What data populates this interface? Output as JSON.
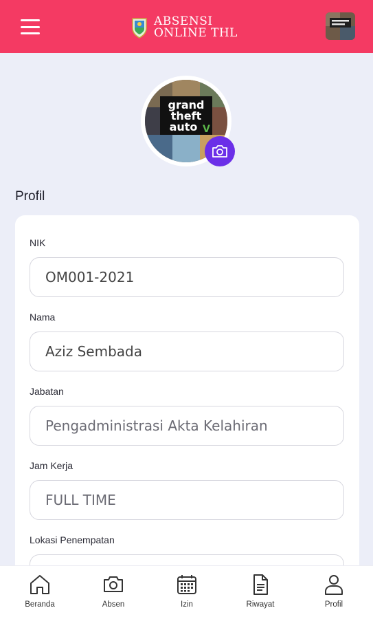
{
  "header": {
    "title_line1": "ABSENSI",
    "title_line2": "ONLINE THL",
    "menu_icon": "hamburger-menu-icon",
    "avatar_icon": "user-avatar-thumbnail"
  },
  "profile_photo": {
    "image_text_1": "grand",
    "image_text_2": "theft",
    "image_text_3": "auto",
    "badge_icon": "camera-icon"
  },
  "section": {
    "title": "Profil"
  },
  "form": {
    "fields": [
      {
        "label": "NIK",
        "value": "OM001-2021"
      },
      {
        "label": "Nama",
        "value": "Aziz Sembada"
      },
      {
        "label": "Jabatan",
        "value": "Pengadministrasi Akta Kelahiran"
      },
      {
        "label": "Jam Kerja",
        "value": "FULL TIME"
      },
      {
        "label": "Lokasi Penempatan",
        "value": ""
      }
    ]
  },
  "nav": {
    "items": [
      {
        "label": "Beranda",
        "icon": "home-icon"
      },
      {
        "label": "Absen",
        "icon": "camera-icon"
      },
      {
        "label": "Izin",
        "icon": "calendar-icon"
      },
      {
        "label": "Riwayat",
        "icon": "document-icon"
      },
      {
        "label": "Profil",
        "icon": "user-icon"
      }
    ]
  },
  "colors": {
    "header_bg": "#f43a63",
    "accent": "#6b2fe8",
    "page_bg": "#eceef8"
  }
}
